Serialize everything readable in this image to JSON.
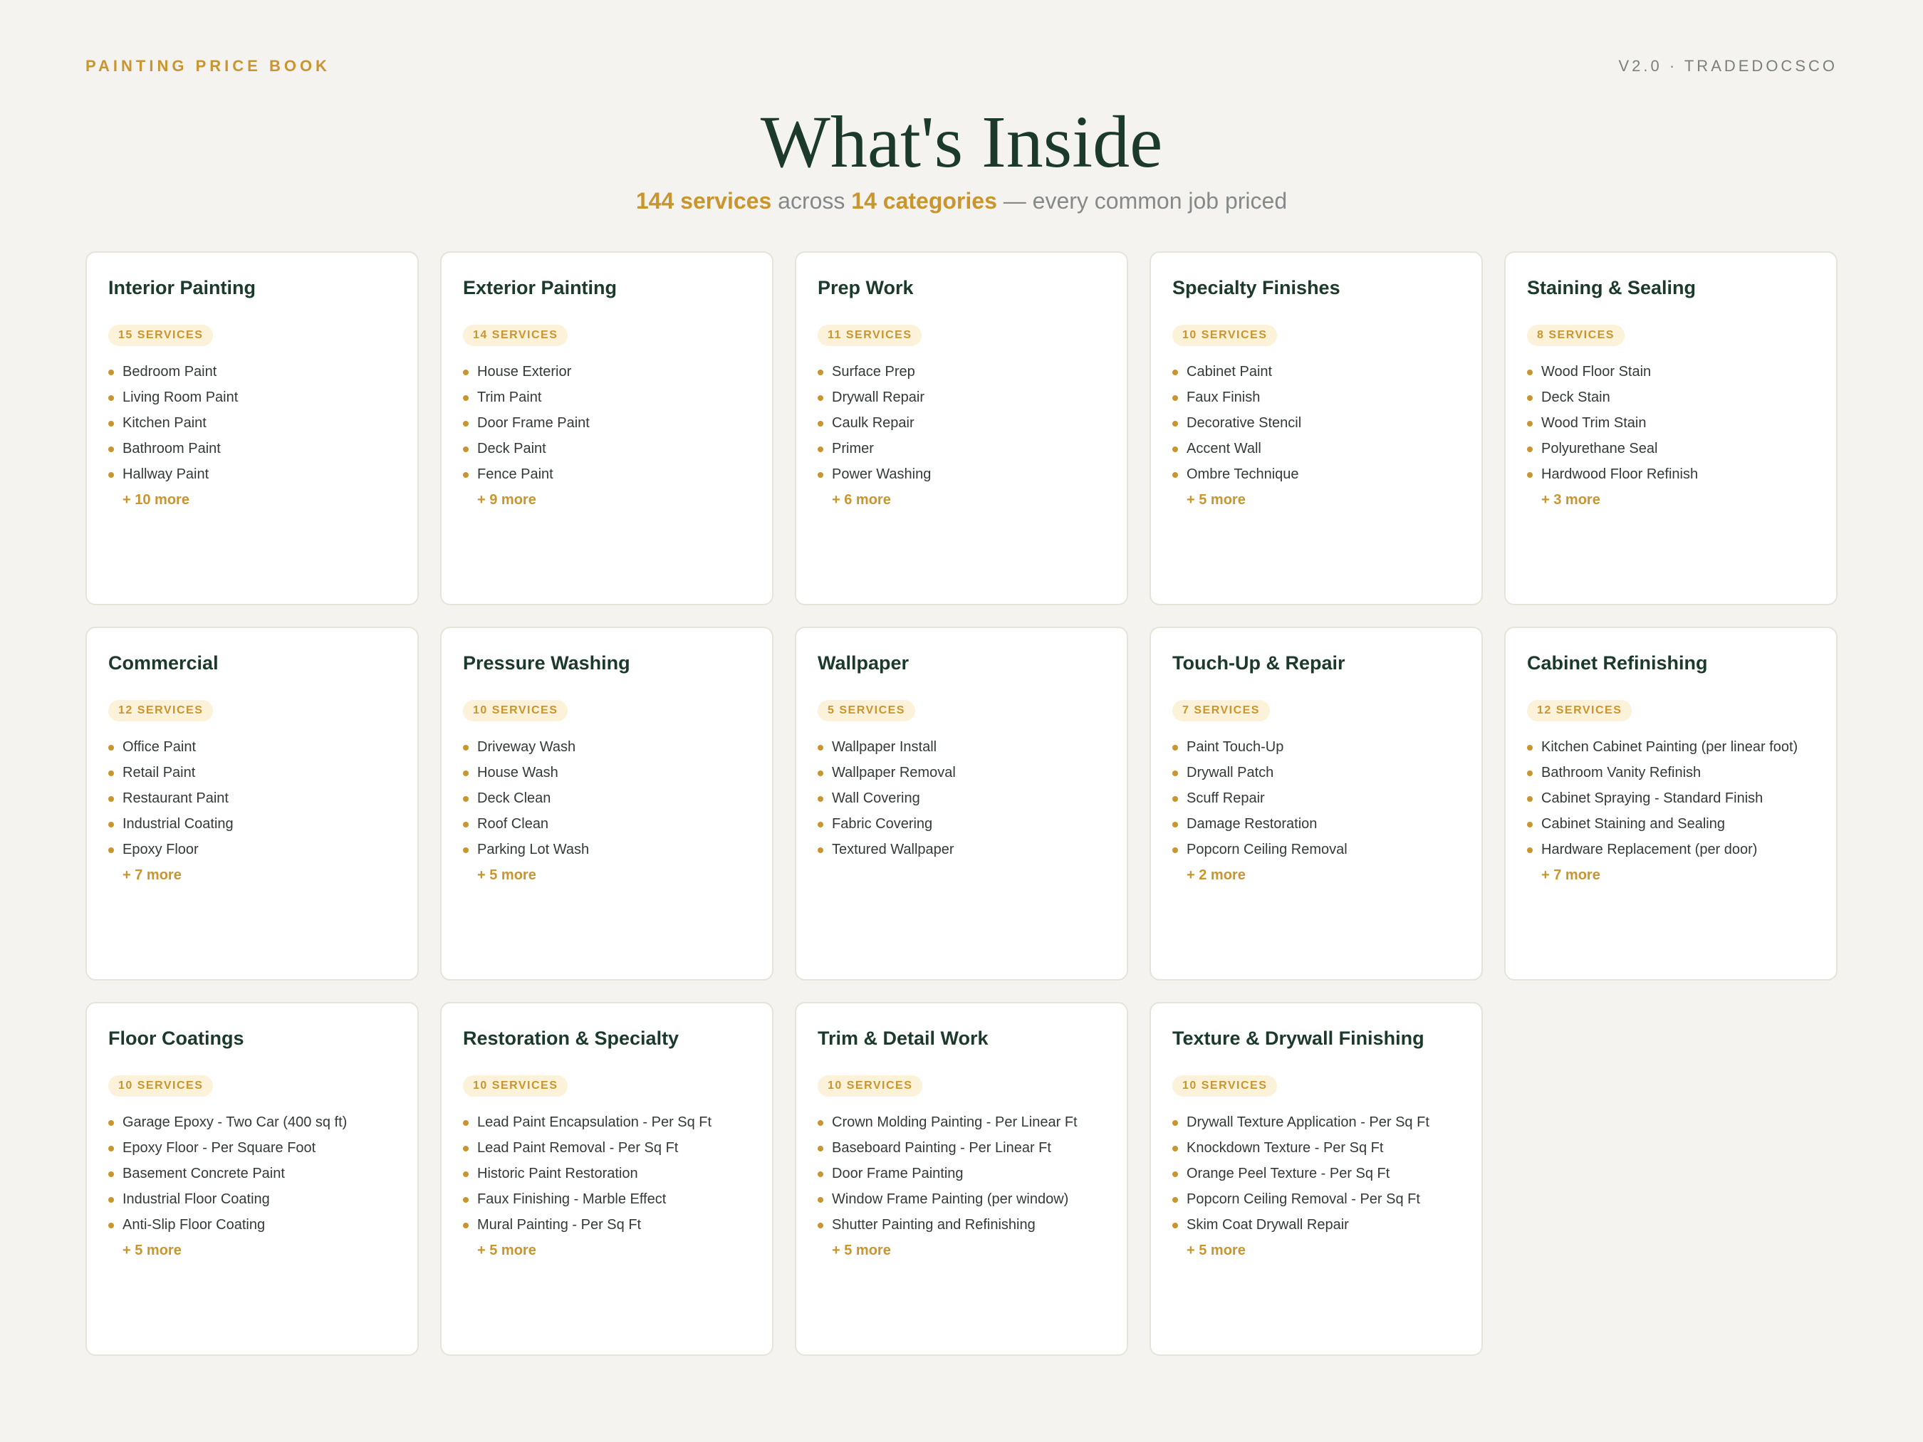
{
  "header": {
    "brand": "PAINTING PRICE BOOK",
    "version": "V2.0 · TRADEDOCSCO",
    "title": "What's Inside",
    "subtitle": {
      "services": "144 services",
      "across": " across ",
      "categories": "14 categories",
      "rest": " — every common job priced"
    }
  },
  "colors": {
    "accent": "#c9952e",
    "heading": "#1c3a2c",
    "background": "#f4f3ef",
    "badge_bg": "#fcf2d9"
  },
  "categories": [
    {
      "title": "Interior Painting",
      "badge": "15 SERVICES",
      "items": [
        "Bedroom Paint",
        "Living Room Paint",
        "Kitchen Paint",
        "Bathroom Paint",
        "Hallway Paint"
      ],
      "more": "+ 10 more"
    },
    {
      "title": "Exterior Painting",
      "badge": "14 SERVICES",
      "items": [
        "House Exterior",
        "Trim Paint",
        "Door Frame Paint",
        "Deck Paint",
        "Fence Paint"
      ],
      "more": "+ 9 more"
    },
    {
      "title": "Prep Work",
      "badge": "11 SERVICES",
      "items": [
        "Surface Prep",
        "Drywall Repair",
        "Caulk Repair",
        "Primer",
        "Power Washing"
      ],
      "more": "+ 6 more"
    },
    {
      "title": "Specialty Finishes",
      "badge": "10 SERVICES",
      "items": [
        "Cabinet Paint",
        "Faux Finish",
        "Decorative Stencil",
        "Accent Wall",
        "Ombre Technique"
      ],
      "more": "+ 5 more"
    },
    {
      "title": "Staining & Sealing",
      "badge": "8 SERVICES",
      "items": [
        "Wood Floor Stain",
        "Deck Stain",
        "Wood Trim Stain",
        "Polyurethane Seal",
        "Hardwood Floor Refinish"
      ],
      "more": "+ 3 more"
    },
    {
      "title": "Commercial",
      "badge": "12 SERVICES",
      "items": [
        "Office Paint",
        "Retail Paint",
        "Restaurant Paint",
        "Industrial Coating",
        "Epoxy Floor"
      ],
      "more": "+ 7 more"
    },
    {
      "title": "Pressure Washing",
      "badge": "10 SERVICES",
      "items": [
        "Driveway Wash",
        "House Wash",
        "Deck Clean",
        "Roof Clean",
        "Parking Lot Wash"
      ],
      "more": "+ 5 more"
    },
    {
      "title": "Wallpaper",
      "badge": "5 SERVICES",
      "items": [
        "Wallpaper Install",
        "Wallpaper Removal",
        "Wall Covering",
        "Fabric Covering",
        "Textured Wallpaper"
      ],
      "more": ""
    },
    {
      "title": "Touch-Up & Repair",
      "badge": "7 SERVICES",
      "items": [
        "Paint Touch-Up",
        "Drywall Patch",
        "Scuff Repair",
        "Damage Restoration",
        "Popcorn Ceiling Removal"
      ],
      "more": "+ 2 more"
    },
    {
      "title": "Cabinet Refinishing",
      "badge": "12 SERVICES",
      "items": [
        "Kitchen Cabinet Painting (per linear foot)",
        "Bathroom Vanity Refinish",
        "Cabinet Spraying - Standard Finish",
        "Cabinet Staining and Sealing",
        "Hardware Replacement (per door)"
      ],
      "more": "+ 7 more"
    },
    {
      "title": "Floor Coatings",
      "badge": "10 SERVICES",
      "items": [
        "Garage Epoxy - Two Car (400 sq ft)",
        "Epoxy Floor - Per Square Foot",
        "Basement Concrete Paint",
        "Industrial Floor Coating",
        "Anti-Slip Floor Coating"
      ],
      "more": "+ 5 more"
    },
    {
      "title": "Restoration & Specialty",
      "badge": "10 SERVICES",
      "items": [
        "Lead Paint Encapsulation - Per Sq Ft",
        "Lead Paint Removal - Per Sq Ft",
        "Historic Paint Restoration",
        "Faux Finishing - Marble Effect",
        "Mural Painting - Per Sq Ft"
      ],
      "more": "+ 5 more"
    },
    {
      "title": "Trim & Detail Work",
      "badge": "10 SERVICES",
      "items": [
        "Crown Molding Painting - Per Linear Ft",
        "Baseboard Painting - Per Linear Ft",
        "Door Frame Painting",
        "Window Frame Painting (per window)",
        "Shutter Painting and Refinishing"
      ],
      "more": "+ 5 more"
    },
    {
      "title": "Texture & Drywall Finishing",
      "badge": "10 SERVICES",
      "items": [
        "Drywall Texture Application - Per Sq Ft",
        "Knockdown Texture - Per Sq Ft",
        "Orange Peel Texture - Per Sq Ft",
        "Popcorn Ceiling Removal - Per Sq Ft",
        "Skim Coat Drywall Repair"
      ],
      "more": "+ 5 more"
    }
  ]
}
